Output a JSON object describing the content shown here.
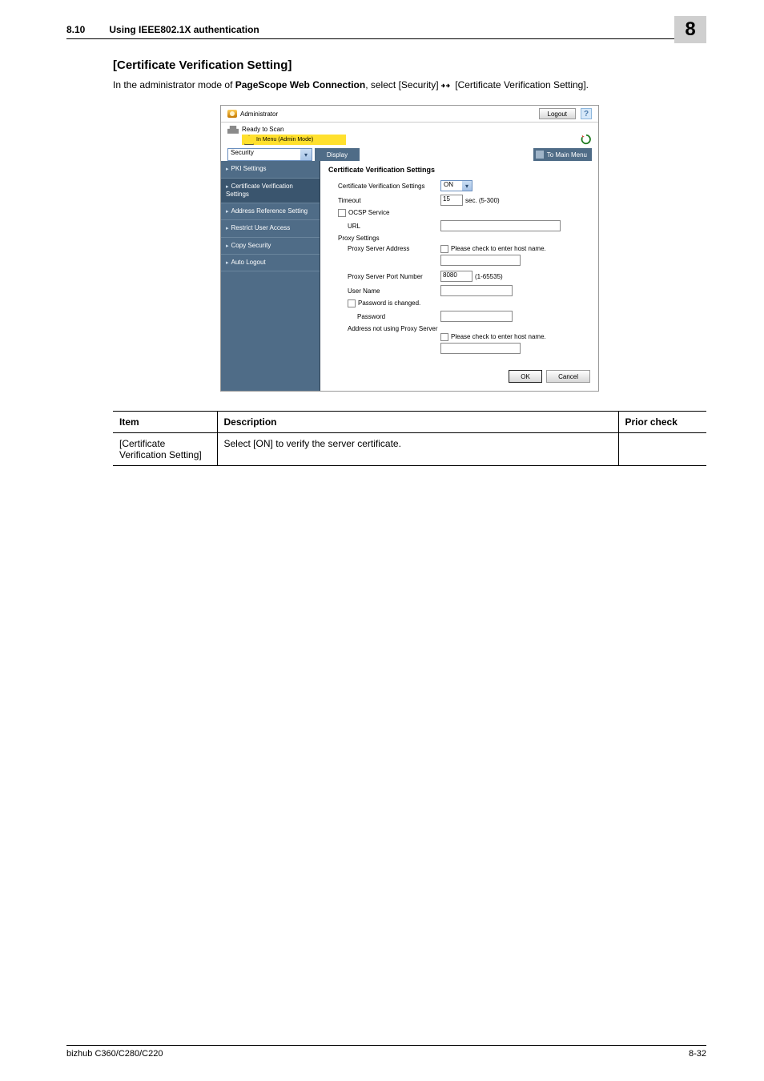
{
  "header": {
    "section_number": "8.10",
    "section_title": "Using IEEE802.1X authentication",
    "chapter_number": "8"
  },
  "heading": "[Certificate Verification Setting]",
  "intro": {
    "prefix": "In the administrator mode of ",
    "bold": "PageScope Web Connection",
    "mid": ", select [Security] ",
    "suffix": " [Certificate Verification Setting]."
  },
  "screenshot": {
    "admin_label": "Administrator",
    "logout": "Logout",
    "help": "?",
    "status_ready": "Ready to Scan",
    "status_warn": "In Menu (Admin Mode)",
    "mode_select": "Security",
    "display_btn": "Display",
    "to_main_menu": "To Main Menu",
    "side": [
      "PKI Settings",
      "Certificate Verification Settings",
      "Address Reference Setting",
      "Restrict User Access",
      "Copy Security",
      "Auto Logout"
    ],
    "main_heading": "Certificate Verification Settings",
    "rows": {
      "cvs_label": "Certificate Verification Settings",
      "cvs_value": "ON",
      "timeout_label": "Timeout",
      "timeout_value": "15",
      "timeout_unit": "sec. (5-300)",
      "ocsp_label": "OCSP Service",
      "url_label": "URL",
      "proxy_settings": "Proxy Settings",
      "psa_label": "Proxy Server Address",
      "host_check": "Please check to enter host name.",
      "pspn_label": "Proxy Server Port Number",
      "pspn_value": "8080",
      "pspn_range": "(1-65535)",
      "username_label": "User Name",
      "pw_changed": "Password is changed.",
      "pw_label": "Password",
      "anups_label": "Address not using Proxy Server",
      "host_check2": "Please check to enter host name."
    },
    "ok_btn": "OK",
    "cancel_btn": "Cancel"
  },
  "table": {
    "h_item": "Item",
    "h_desc": "Description",
    "h_prior": "Prior check",
    "r1_item": "[Certificate Verification Setting]",
    "r1_desc": "Select [ON] to verify the server certificate."
  },
  "footer": {
    "left": "bizhub C360/C280/C220",
    "right": "8-32"
  }
}
